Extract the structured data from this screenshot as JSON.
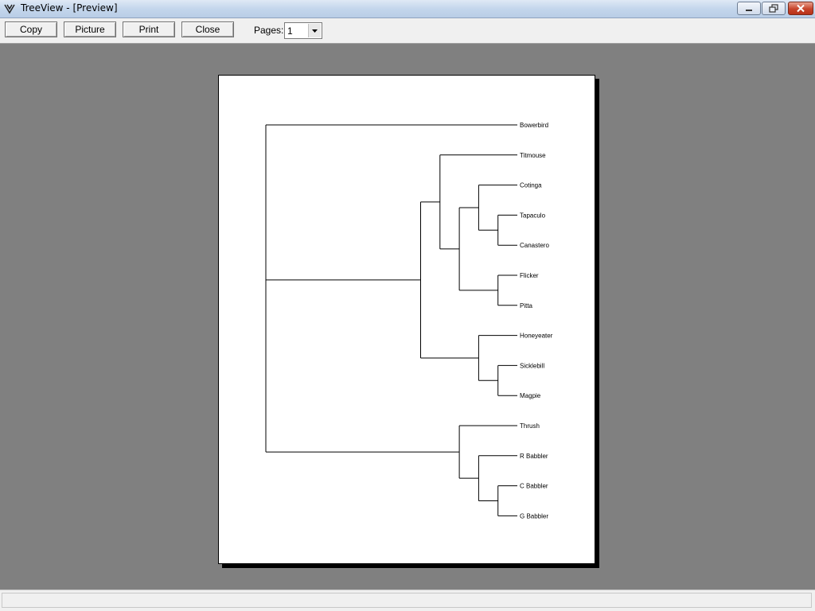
{
  "window": {
    "title": "TreeView - [Preview]",
    "controls": {
      "minimize_icon": "minimize-icon",
      "maximize_icon": "restore-icon",
      "close_icon": "close-icon"
    }
  },
  "toolbar": {
    "copy_label": "Copy",
    "picture_label": "Picture",
    "print_label": "Print",
    "close_label": "Close",
    "pages_label": "Pages:",
    "pages_value": "1"
  },
  "tree": {
    "leaves": [
      "Bowerbird",
      "Titmouse",
      "Cotinga",
      "Tapaculo",
      "Canastero",
      "Flicker",
      "Pitta",
      "Honeyeater",
      "Sicklebill",
      "Magpie",
      "Thrush",
      "R Babbler",
      "C Babbler",
      "G Babbler"
    ],
    "newick": "(Bowerbird,((Titmouse,((Cotinga,(Tapaculo,Canastero)),(Flicker,Pitta))),(Honeyeater,(Sicklebill,Magpie))),(Thrush,(R Babbler,(C Babbler,G Babbler))));"
  },
  "statusbar": {
    "text": ""
  },
  "colors": {
    "canvas": "#808080",
    "page": "#ffffff",
    "titlebar": "#c4d6ec"
  }
}
